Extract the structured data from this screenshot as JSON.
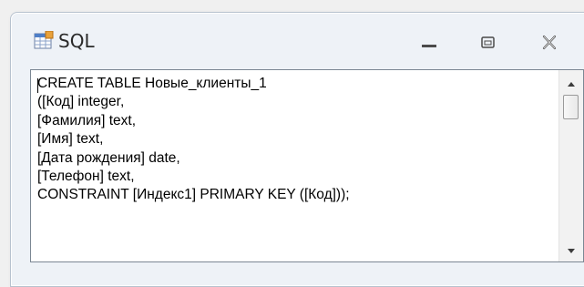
{
  "window": {
    "title": "SQL",
    "app_icon": "datasheet-sql-icon",
    "controls": [
      "minimize-icon",
      "maximize-icon",
      "close-icon"
    ]
  },
  "editor": {
    "lines": [
      "CREATE TABLE Новые_клиенты_1",
      "([Код] integer,",
      "[Фамилия] text,",
      "[Имя] text,",
      "[Дата рождения] date,",
      "[Телефон] text,",
      "CONSTRAINT [Индекс1] PRIMARY KEY ([Код]));"
    ]
  },
  "colors": {
    "titlebar_bg": "#eef2f7",
    "editor_bg": "#ffffff",
    "border": "#7b8793"
  }
}
